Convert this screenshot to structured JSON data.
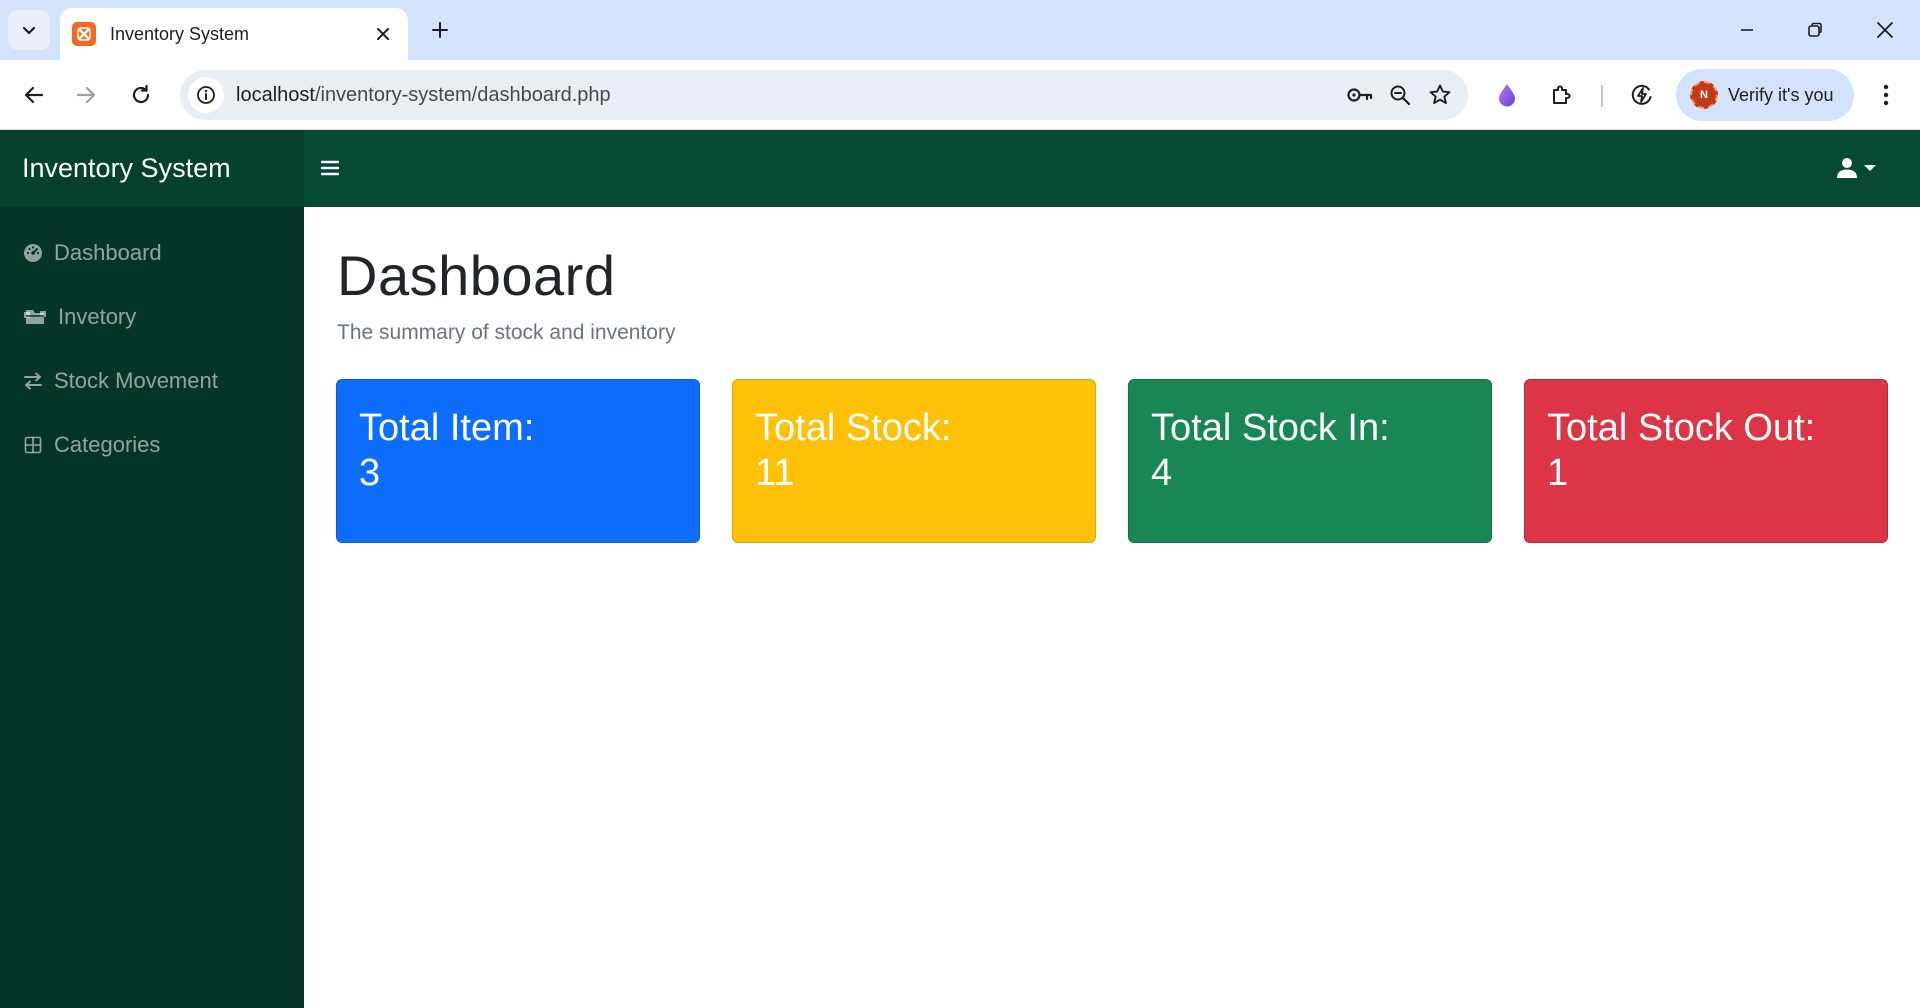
{
  "browser": {
    "tab_title": "Inventory System",
    "url_host": "localhost",
    "url_path": "/inventory-system/dashboard.php",
    "profile_chip": "Verify it's you",
    "profile_initial": "N"
  },
  "app": {
    "brand": "Inventory System",
    "sidebar": {
      "items": [
        {
          "label": "Dashboard",
          "icon": "gauge-icon"
        },
        {
          "label": "Invetory",
          "icon": "boxes-icon"
        },
        {
          "label": "Stock Movement",
          "icon": "arrows-left-right-icon"
        },
        {
          "label": "Categories",
          "icon": "grid-icon"
        }
      ]
    },
    "main": {
      "title": "Dashboard",
      "subtitle": "The summary of stock and inventory",
      "cards": [
        {
          "label": "Total Item:",
          "value": "3",
          "color": "#0d6efd"
        },
        {
          "label": "Total Stock:",
          "value": "11",
          "color": "#ffc107"
        },
        {
          "label": "Total Stock In:",
          "value": "4",
          "color": "#198754"
        },
        {
          "label": "Total Stock Out:",
          "value": "1",
          "color": "#dc3545"
        }
      ]
    }
  },
  "colors": {
    "navbar": "#064a34",
    "brand_bg": "#05412d",
    "sidebar": "#053526",
    "tabstrip": "#d3e3fd"
  }
}
